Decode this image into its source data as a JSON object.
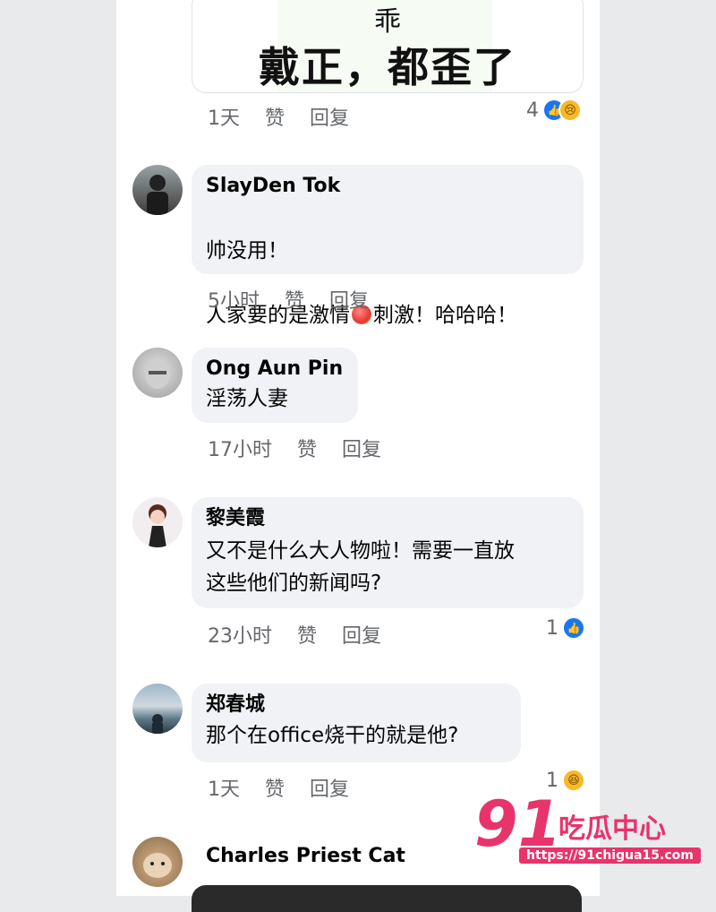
{
  "top_image_card": {
    "line1": "乖",
    "line2": "戴正，都歪了"
  },
  "top_meta": {
    "time": "1天",
    "like": "赞",
    "reply": "回复"
  },
  "top_reactions": {
    "count": "4",
    "icons": [
      "like-icon",
      "sad-icon"
    ]
  },
  "comments": [
    {
      "name": "SlayDen Tok",
      "line1": "帅没用！",
      "line2a": "人家要的是激情",
      "line2b": "刺激！哈哈哈！",
      "emoji": "heart-on-fire-icon",
      "time": "5小时",
      "like": "赞",
      "reply": "回复"
    },
    {
      "name": "Ong Aun Pin",
      "text": "淫荡人妻",
      "time": "17小时",
      "like": "赞",
      "reply": "回复"
    },
    {
      "name": "黎美霞",
      "text": "又不是什么大人物啦！需要一直放\n这些他们的新闻吗?",
      "time": "23小时",
      "like": "赞",
      "reply": "回复",
      "reactions": {
        "count": "1",
        "icons": [
          "like-icon"
        ]
      }
    },
    {
      "name": "郑春城",
      "text": "那个在office烧干的就是他?",
      "time": "1天",
      "like": "赞",
      "reply": "回复",
      "reactions": {
        "count": "1",
        "icons": [
          "haha-icon"
        ]
      }
    },
    {
      "name": "Charles Priest Cat"
    }
  ],
  "watermark": {
    "number": "91",
    "brand": "吃瓜中心",
    "url": "https://91chigua15.com"
  },
  "colors": {
    "like_blue": "#1877f2",
    "bubble": "#f0f2f5",
    "meta_gray": "#65676b",
    "watermark_pink": "#e8336b"
  }
}
